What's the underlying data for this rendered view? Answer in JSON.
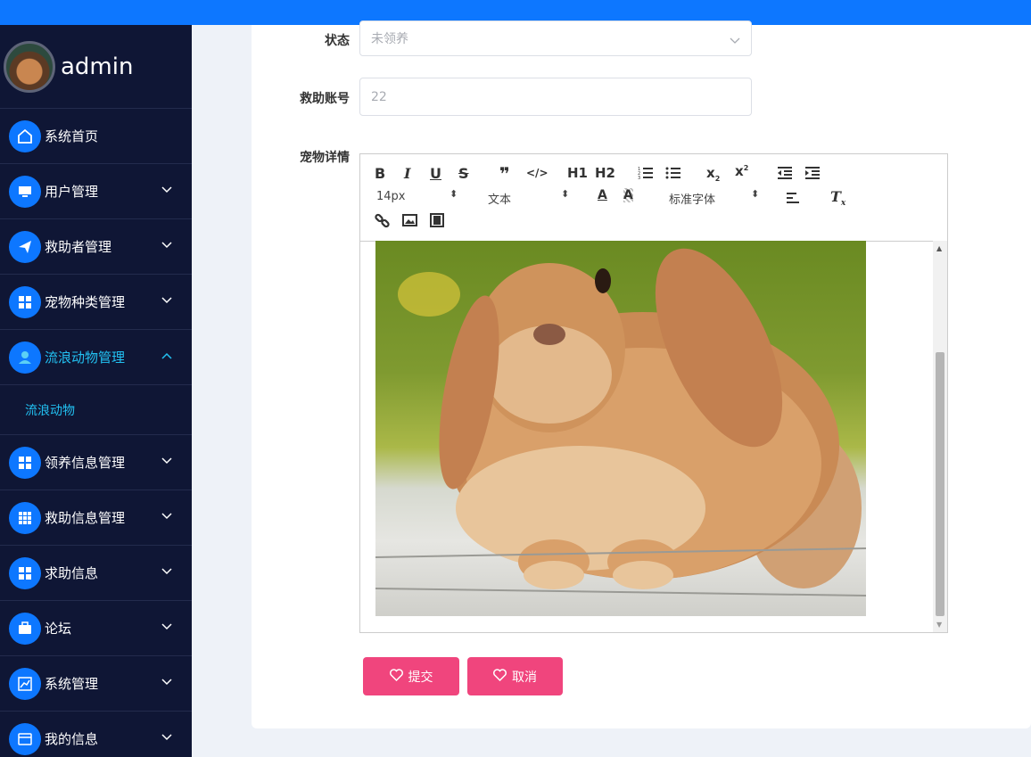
{
  "profile": {
    "name": "admin"
  },
  "sidebar": {
    "items": [
      {
        "label": "系统首页",
        "icon": "home-icon"
      },
      {
        "label": "用户管理",
        "icon": "monitor-icon"
      },
      {
        "label": "救助者管理",
        "icon": "send-icon"
      },
      {
        "label": "宠物种类管理",
        "icon": "grid-icon"
      },
      {
        "label": "流浪动物管理",
        "icon": "user-icon"
      },
      {
        "label": "领养信息管理",
        "icon": "grid-icon"
      },
      {
        "label": "救助信息管理",
        "icon": "apps-icon"
      },
      {
        "label": "求助信息",
        "icon": "grid-icon"
      },
      {
        "label": "论坛",
        "icon": "briefcase-icon"
      },
      {
        "label": "系统管理",
        "icon": "chart-icon"
      },
      {
        "label": "我的信息",
        "icon": "card-icon"
      }
    ],
    "submenu": {
      "label": "流浪动物"
    }
  },
  "form": {
    "status": {
      "label": "状态",
      "placeholder": "未领养"
    },
    "rescuer_account": {
      "label": "救助账号",
      "value": "22"
    },
    "pet_detail": {
      "label": "宠物详情"
    }
  },
  "editor": {
    "font_size": "14px",
    "paragraph": "文本",
    "font_family": "标准字体",
    "h1": "H1",
    "h2": "H2"
  },
  "buttons": {
    "submit": "提交",
    "cancel": "取消"
  },
  "colors": {
    "accent": "#0d77ff",
    "sidebar_bg": "#0f1635",
    "active": "#22c1f2",
    "button": "#f0457d"
  }
}
